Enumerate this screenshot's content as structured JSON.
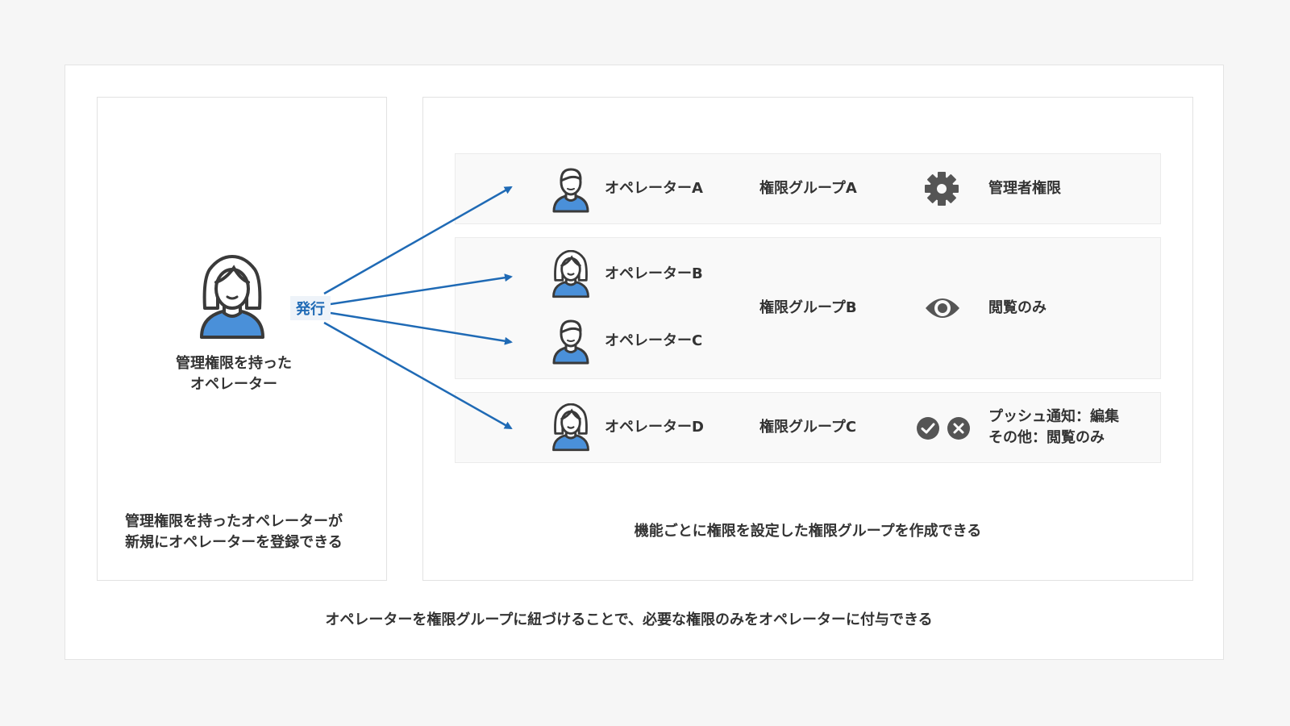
{
  "admin": {
    "label_line1": "管理権限を持った",
    "label_line2": "オペレーター"
  },
  "issue_label": "発行",
  "left_caption": {
    "line1": "管理権限を持ったオペレーターが",
    "line2": "新規にオペレーターを登録できる"
  },
  "operators": {
    "a": "オペレーターA",
    "b": "オペレーターB",
    "c": "オペレーターC",
    "d": "オペレーターD"
  },
  "groups": {
    "a": "権限グループA",
    "b": "権限グループB",
    "c": "権限グループC"
  },
  "permissions": {
    "a": {
      "icon": "gear-icon",
      "label": "管理者権限"
    },
    "b": {
      "icon": "eye-icon",
      "label": "閲覧のみ"
    },
    "c": {
      "icons": [
        "check-circle-icon",
        "x-circle-icon"
      ],
      "line1": "プッシュ通知：編集",
      "line2": "その他：閲覧のみ"
    }
  },
  "right_caption": "機能ごとに権限を設定した権限グループを作成できる",
  "footer_caption": "オペレーターを権限グループに紐づけることで、必要な権限のみをオペレーターに付与できる",
  "colors": {
    "accent": "#1f6ab5",
    "avatar_body": "#4a90d9",
    "icon_gray": "#555555"
  }
}
